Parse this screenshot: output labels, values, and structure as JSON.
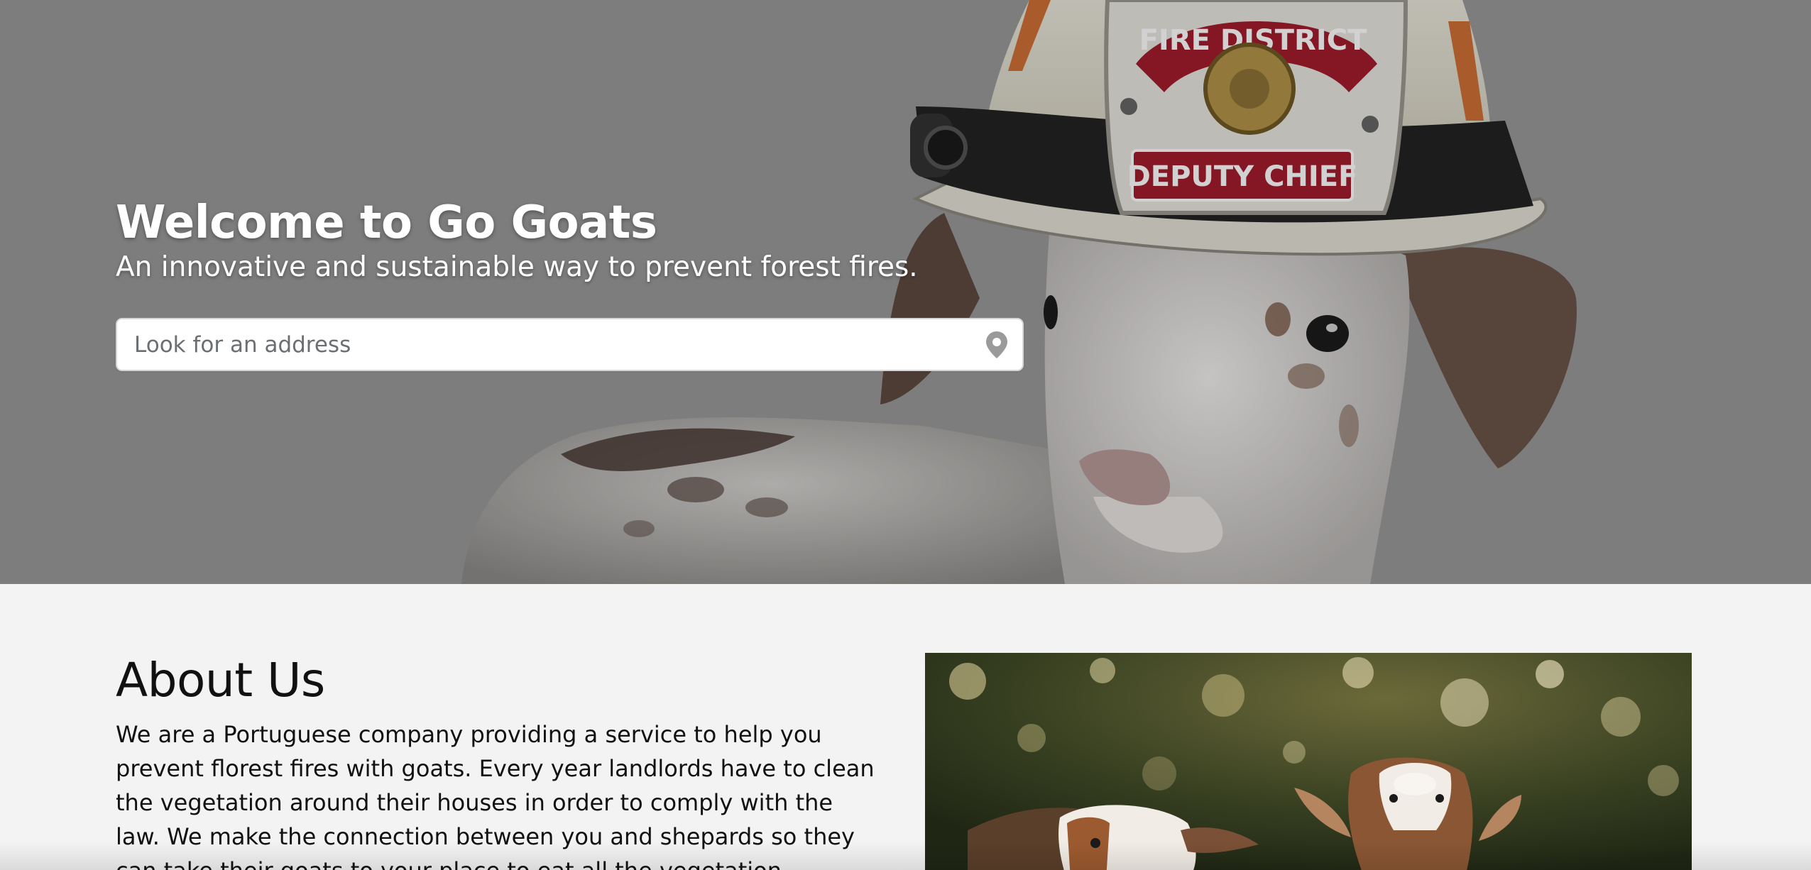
{
  "hero": {
    "title": "Welcome to Go Goats",
    "subtitle": "An innovative and sustainable way to prevent forest fires.",
    "helmet_text_top": "FIRE DISTRICT",
    "helmet_text_bottom": "DEPUTY CHIEF",
    "search": {
      "placeholder": "Look for an address",
      "value": "",
      "icon": "map-pin-icon"
    }
  },
  "about": {
    "title": "About Us",
    "text": "We are a Portuguese company providing a service to help you prevent florest fires with goats. Every year landlords have to clean the vegetation around their houses in order to comply with the law. We make the connection between you and shepards so they can take their goats to your place to eat all the vegetation."
  },
  "colors": {
    "hero_background": "#999999",
    "page_background": "#f3f3f3",
    "helmet_badge_red": "#a31d2d"
  }
}
